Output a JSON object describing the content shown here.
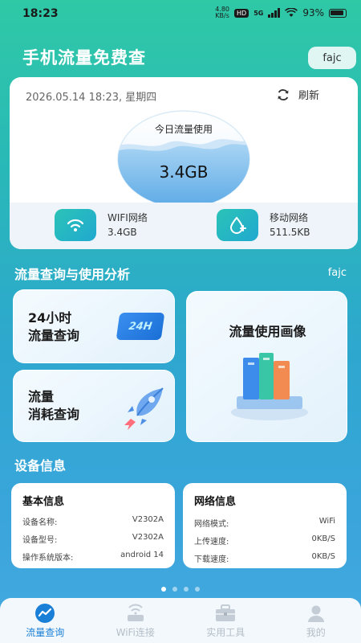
{
  "status": {
    "time": "18:23",
    "speed_value": "4.80",
    "speed_unit": "KB/s",
    "hd": "HD",
    "network": "5G",
    "battery": "93%"
  },
  "header": {
    "title": "手机流量免费查",
    "user": "fajc"
  },
  "usage_card": {
    "datetime": "2026.05.14 18:23, 星期四",
    "refresh_label": "刷新",
    "gauge_label": "今日流量使用",
    "gauge_value": "3.4GB",
    "wifi_label": "WIFI网络",
    "wifi_value": "3.4GB",
    "mobile_label": "移动网络",
    "mobile_value": "511.5KB"
  },
  "analysis": {
    "title": "流量查询与使用分析",
    "user": "fajc",
    "card1_line1": "24小时",
    "card1_line2": "流量查询",
    "card1_badge": "24H",
    "card2_line1": "流量",
    "card2_line2": "消耗查询",
    "card3_title": "流量使用画像"
  },
  "device": {
    "title": "设备信息",
    "basic": {
      "title": "基本信息",
      "rows": [
        {
          "label": "设备名称:",
          "value": "V2302A"
        },
        {
          "label": "设备型号:",
          "value": "V2302A"
        },
        {
          "label": "操作系统版本:",
          "value": "android 14"
        }
      ]
    },
    "network": {
      "title": "网络信息",
      "rows": [
        {
          "label": "网络模式:",
          "value": "WiFi"
        },
        {
          "label": "上传速度:",
          "value": "0KB/S"
        },
        {
          "label": "下载速度:",
          "value": "0KB/S"
        }
      ]
    }
  },
  "nav": {
    "items": [
      {
        "label": "流量查询",
        "icon": "traffic-chart-icon"
      },
      {
        "label": "WiFi连接",
        "icon": "wifi-router-icon"
      },
      {
        "label": "实用工具",
        "icon": "toolbox-icon"
      },
      {
        "label": "我的",
        "icon": "user-icon"
      }
    ]
  },
  "colors": {
    "accent": "#1a7fd6",
    "teal": "#2bc3b7"
  }
}
